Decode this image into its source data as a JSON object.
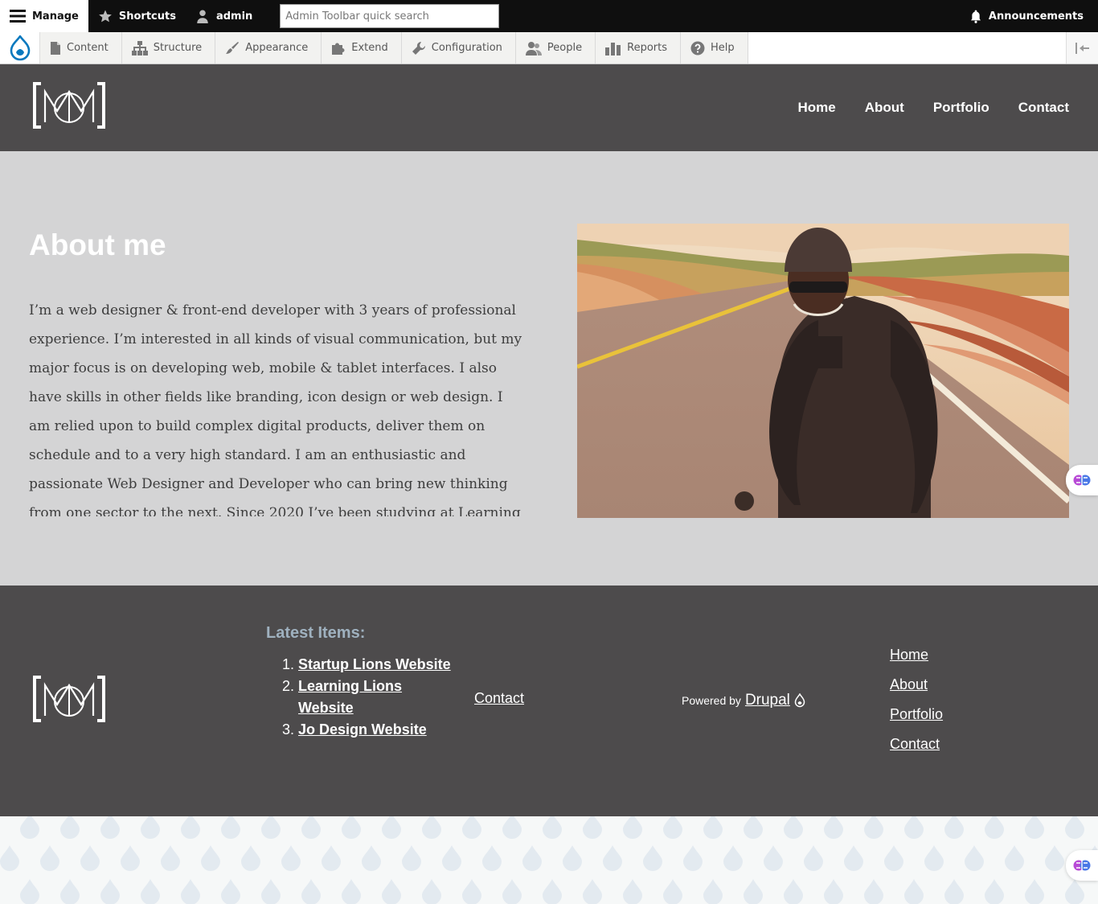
{
  "admin_toolbar": {
    "manage": "Manage",
    "shortcuts": "Shortcuts",
    "user": "admin",
    "search_placeholder": "Admin Toolbar quick search",
    "announcements": "Announcements"
  },
  "admin_tray": {
    "items": [
      {
        "label": "Content",
        "icon": "file-icon"
      },
      {
        "label": "Structure",
        "icon": "sitemap-icon"
      },
      {
        "label": "Appearance",
        "icon": "paintbrush-icon"
      },
      {
        "label": "Extend",
        "icon": "puzzle-icon"
      },
      {
        "label": "Configuration",
        "icon": "wrench-icon"
      },
      {
        "label": "People",
        "icon": "people-icon"
      },
      {
        "label": "Reports",
        "icon": "bar-chart-icon"
      },
      {
        "label": "Help",
        "icon": "help-icon"
      }
    ]
  },
  "header": {
    "nav": [
      "Home",
      "About",
      "Portfolio",
      "Contact"
    ]
  },
  "main": {
    "title": "About me",
    "body": "I’m a web designer & front-end developer with 3 years of professional experience. I’m interested in all kinds of visual communication, but my major focus is on developing web, mobile & tablet interfaces. I also have skills in other fields like branding, icon design or web design. I am relied upon to build complex digital products, deliver them on schedule and to a very high standard. I am an enthusiastic and passionate Web Designer and Developer who can bring new thinking from one sector to the next. Since 2020 I’ve been studying at Learning Lions where I currently work"
  },
  "footer": {
    "latest_title": "Latest Items:",
    "latest_items": [
      "Startup Lions Website",
      "Learning Lions Website",
      "Jo Design Website"
    ],
    "contact": "Contact",
    "powered_by": "Powered by",
    "drupal": "Drupal",
    "nav": [
      "Home",
      "About",
      "Portfolio",
      "Contact"
    ]
  },
  "colors": {
    "admin_bar": "#0f0f0f",
    "header_bg": "#4d4b4c",
    "main_bg": "#d4d4d5",
    "drupal_blue": "#0678be",
    "latest_title": "#9fb1bf"
  }
}
